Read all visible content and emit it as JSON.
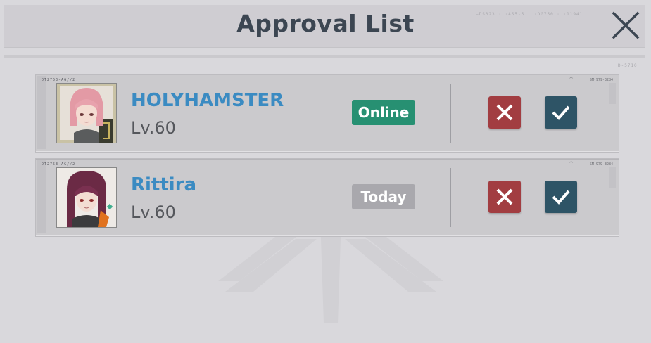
{
  "header": {
    "title": "Approval List",
    "deco_codes": "—DS323 · ·AS5-5 · ·DG750 · ·11941",
    "deco_side": "D-5710"
  },
  "requests": [
    {
      "name": "HOLYHAMSTER",
      "level": "Lv.60",
      "status": "Online",
      "status_color": "#279072",
      "card_tag_left": "DT2753-AG//2",
      "card_tag_right": "SM-979-3284"
    },
    {
      "name": "Rittira",
      "level": "Lv.60",
      "status": "Today",
      "status_color": "#a9a8ad",
      "card_tag_left": "DT2753-AG//2",
      "card_tag_right": "SM-979-3284"
    }
  ],
  "colors": {
    "accent_name": "#3b8bc2",
    "reject": "#a23d41",
    "accept": "#2e5466"
  },
  "icons": {
    "close": "close-icon",
    "reject": "x-icon",
    "accept": "check-icon"
  }
}
